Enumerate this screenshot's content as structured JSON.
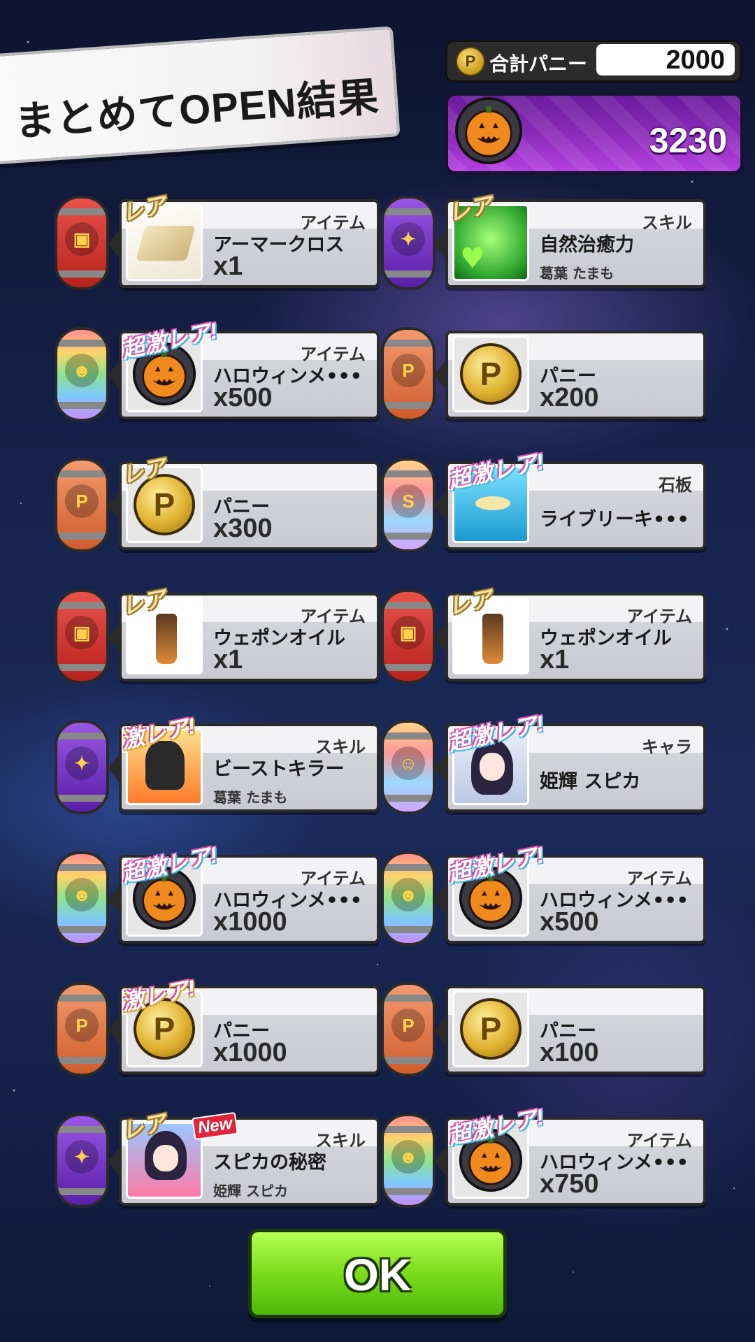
{
  "header": {
    "title": "まとめてOPEN結果",
    "total_label": "合計パニー",
    "total_value": "2000",
    "coin_symbol": "P",
    "medal_value": "3230"
  },
  "cards": [
    {
      "badge": "レア",
      "category": "アイテム",
      "name": "アーマークロス",
      "qty": "x1",
      "owner": "",
      "icon": "armor-cloth"
    },
    {
      "badge": "レア",
      "category": "スキル",
      "name": "自然治癒力",
      "qty": "",
      "owner": "葛葉 たまも",
      "icon": "skill-heal"
    },
    {
      "badge": "超激レア!",
      "category": "アイテム",
      "name": "ハロウィンメ•••",
      "qty": "x500",
      "owner": "",
      "icon": "halloween-medal"
    },
    {
      "badge": "",
      "category": "",
      "name": "パニー",
      "qty": "x200",
      "owner": "",
      "icon": "panii-coin"
    },
    {
      "badge": "レア",
      "category": "",
      "name": "パニー",
      "qty": "x300",
      "owner": "",
      "icon": "panii-coin"
    },
    {
      "badge": "超激レア!",
      "category": "石板",
      "name": "ライブリーキ•••",
      "qty": "",
      "owner": "",
      "icon": "stone-tablet"
    },
    {
      "badge": "レア",
      "category": "アイテム",
      "name": "ウェポンオイル",
      "qty": "x1",
      "owner": "",
      "icon": "weapon-oil"
    },
    {
      "badge": "レア",
      "category": "アイテム",
      "name": "ウェポンオイル",
      "qty": "x1",
      "owner": "",
      "icon": "weapon-oil"
    },
    {
      "badge": "激レア!",
      "category": "スキル",
      "name": "ビーストキラー",
      "qty": "",
      "owner": "葛葉 たまも",
      "icon": "skill-beast"
    },
    {
      "badge": "超激レア!",
      "category": "キャラ",
      "name": "姫輝 スピカ",
      "qty": "",
      "owner": "",
      "icon": "character"
    },
    {
      "badge": "超激レア!",
      "category": "アイテム",
      "name": "ハロウィンメ•••",
      "qty": "x1000",
      "owner": "",
      "icon": "halloween-medal"
    },
    {
      "badge": "超激レア!",
      "category": "アイテム",
      "name": "ハロウィンメ•••",
      "qty": "x500",
      "owner": "",
      "icon": "halloween-medal"
    },
    {
      "badge": "激レア!",
      "category": "",
      "name": "パニー",
      "qty": "x1000",
      "owner": "",
      "icon": "panii-coin"
    },
    {
      "badge": "",
      "category": "",
      "name": "パニー",
      "qty": "x100",
      "owner": "",
      "icon": "panii-coin"
    },
    {
      "badge": "レア",
      "category": "スキル",
      "name": "スピカの秘密",
      "qty": "",
      "owner": "姫輝 スピカ",
      "icon": "skill-secret",
      "new": "New"
    },
    {
      "badge": "超激レア!",
      "category": "アイテム",
      "name": "ハロウィンメ•••",
      "qty": "x750",
      "owner": "",
      "icon": "halloween-medal"
    }
  ],
  "ok_button": {
    "label": "OK"
  }
}
